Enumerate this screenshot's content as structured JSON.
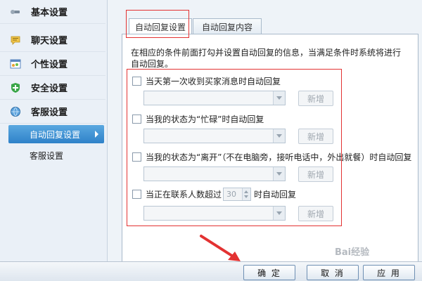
{
  "sidebar": {
    "items": [
      {
        "label": "基本设置",
        "icon": "wrench-icon"
      },
      {
        "label": "聊天设置",
        "icon": "chat-bubble-icon"
      },
      {
        "label": "个性设置",
        "icon": "palette-window-icon"
      },
      {
        "label": "安全设置",
        "icon": "shield-plus-icon"
      },
      {
        "label": "客服设置",
        "icon": "headset-globe-icon"
      }
    ],
    "subitems": [
      {
        "label": "自动回复设置",
        "active": true
      },
      {
        "label": "客服设置",
        "active": false
      }
    ]
  },
  "tabs": [
    {
      "label": "自动回复设置",
      "active": true
    },
    {
      "label": "自动回复内容",
      "active": false
    }
  ],
  "content": {
    "description": "在相应的条件前面打勾并设置自动回复的信息，当满足条件时系统将进行自动回复。",
    "rules": [
      {
        "label": "当天第一次收到买家消息时自动回复",
        "checked": false
      },
      {
        "label": "当我的状态为“忙碌”时自动回复",
        "checked": false
      },
      {
        "label": "当我的状态为“离开”（不在电脑旁，接听电话中，外出就餐）时自动回复",
        "checked": false
      },
      {
        "label_before": "当正在联系人数超过",
        "spinner_value": "30",
        "label_after": "时自动回复",
        "checked": false
      }
    ],
    "add_label": "新增"
  },
  "footer": {
    "ok": "确 定",
    "cancel": "取 消",
    "apply": "应 用"
  },
  "watermark": "Bai经验",
  "colors": {
    "accent": "#2f82c9",
    "annotation": "#e33232"
  }
}
